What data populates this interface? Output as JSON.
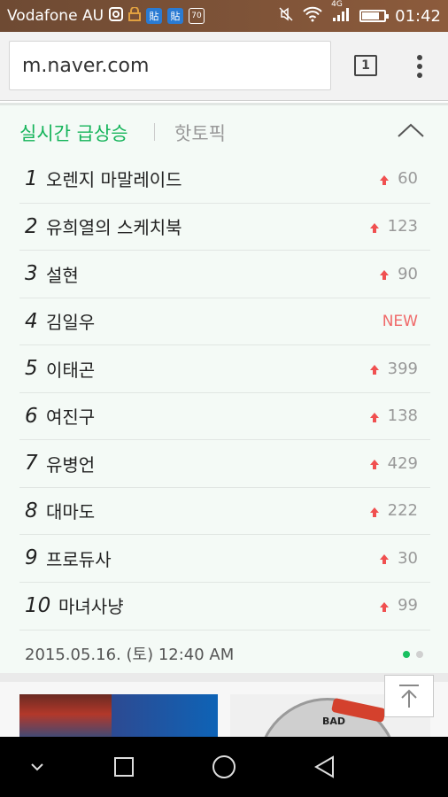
{
  "status_bar": {
    "carrier": "Vodafone AU",
    "notification_badge_1": "貼",
    "notification_badge_2": "貼",
    "notification_badge_3": "70",
    "network": "4G",
    "battery_level": 0.8,
    "time": "01:42"
  },
  "browser": {
    "url": "m.naver.com",
    "tab_count": "1"
  },
  "trending": {
    "tab_active": "실시간 급상승",
    "tab_inactive": "핫토픽",
    "items": [
      {
        "rank": "1",
        "name": "오렌지 마말레이드",
        "change": "60",
        "is_new": false
      },
      {
        "rank": "2",
        "name": "유희열의 스케치북",
        "change": "123",
        "is_new": false
      },
      {
        "rank": "3",
        "name": "설현",
        "change": "90",
        "is_new": false
      },
      {
        "rank": "4",
        "name": "김일우",
        "change": "NEW",
        "is_new": true
      },
      {
        "rank": "5",
        "name": "이태곤",
        "change": "399",
        "is_new": false
      },
      {
        "rank": "6",
        "name": "여진구",
        "change": "138",
        "is_new": false
      },
      {
        "rank": "7",
        "name": "유병언",
        "change": "429",
        "is_new": false
      },
      {
        "rank": "8",
        "name": "대마도",
        "change": "222",
        "is_new": false
      },
      {
        "rank": "9",
        "name": "프로듀사",
        "change": "30",
        "is_new": false
      },
      {
        "rank": "10",
        "name": "마녀사냥",
        "change": "99",
        "is_new": false
      }
    ],
    "timestamp": "2015.05.16. (토) 12:40 AM",
    "page_dots": 2,
    "active_dot": 0
  },
  "content": {
    "gauge_label": "BAD"
  },
  "colors": {
    "accent_green": "#16b45b",
    "up_arrow_red": "#f05050",
    "new_red": "#f06a6a"
  }
}
